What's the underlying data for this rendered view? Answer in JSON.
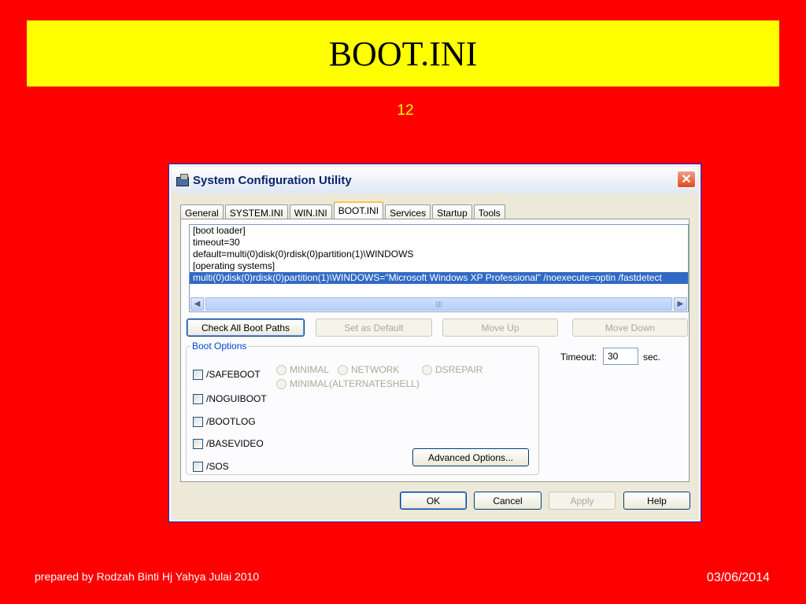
{
  "slide": {
    "title": "BOOT.INI",
    "number": "12",
    "footer_left": "prepared by Rodzah Binti Hj Yahya Julai 2010",
    "footer_right": "03/06/2014"
  },
  "window": {
    "title": "System Configuration Utility",
    "close_glyph": "✕",
    "tabs": [
      {
        "label": "General"
      },
      {
        "label": "SYSTEM.INI"
      },
      {
        "label": "WIN.INI"
      },
      {
        "label": "BOOT.INI"
      },
      {
        "label": "Services"
      },
      {
        "label": "Startup"
      },
      {
        "label": "Tools"
      }
    ],
    "boot_text": [
      "[boot loader]",
      "timeout=30",
      "default=multi(0)disk(0)rdisk(0)partition(1)\\WINDOWS",
      "[operating systems]",
      "multi(0)disk(0)rdisk(0)partition(1)\\WINDOWS=\"Microsoft Windows XP Professional\" /noexecute=optin /fastdetect"
    ],
    "buttons": {
      "check_all": "Check All Boot Paths",
      "set_default": "Set as Default",
      "move_up": "Move Up",
      "move_down": "Move Down",
      "advanced": "Advanced Options...",
      "ok": "OK",
      "cancel": "Cancel",
      "apply": "Apply",
      "help": "Help"
    },
    "boot_options": {
      "label": "Boot Options",
      "checkboxes": [
        "/SAFEBOOT",
        "/NOGUIBOOT",
        "/BOOTLOG",
        "/BASEVIDEO",
        "/SOS"
      ],
      "radios": [
        "MINIMAL",
        "NETWORK",
        "DSREPAIR",
        "MINIMAL(ALTERNATESHELL)"
      ]
    },
    "timeout": {
      "label": "Timeout:",
      "value": "30",
      "unit": "sec."
    }
  },
  "colors": {
    "background": "#ff0000",
    "title_band": "#ffff00",
    "selection": "#316ac5"
  }
}
